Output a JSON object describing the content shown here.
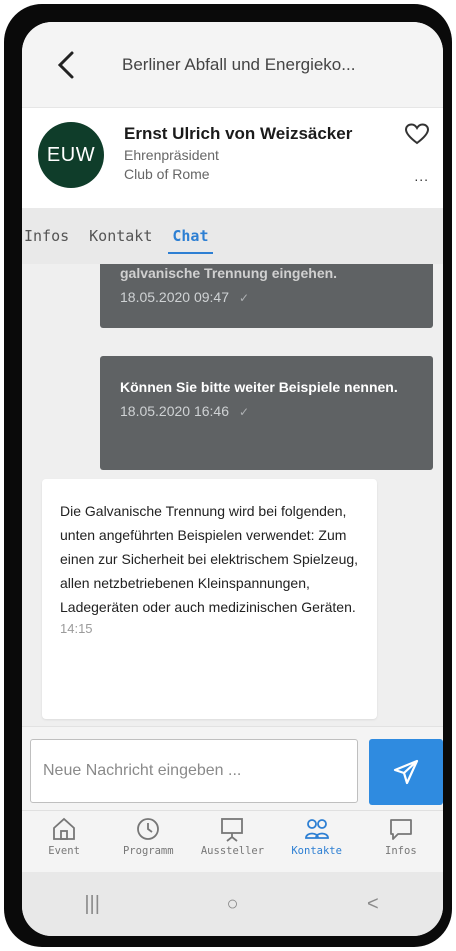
{
  "header": {
    "title": "Berliner Abfall und Energieko..."
  },
  "profile": {
    "avatar_initials": "EUW",
    "name": "Ernst Ulrich von Weizsäcker",
    "role": "Ehrenpräsident",
    "organization": "Club of Rome",
    "more_label": "..."
  },
  "tabs": [
    {
      "label": "Infos",
      "active": false
    },
    {
      "label": "Kontakt",
      "active": false
    },
    {
      "label": "Chat",
      "active": true
    }
  ],
  "messages": [
    {
      "direction": "out",
      "text": "galvanische Trennung eingehen.",
      "time": "18.05.2020 09:47",
      "status": "✓"
    },
    {
      "direction": "out",
      "text": "Können Sie bitte weiter Beispiele nennen.",
      "time": "18.05.2020 16:46",
      "status": "✓"
    },
    {
      "direction": "in",
      "text": "Die Galvanische Trennung wird bei folgenden, unten angeführten Beispielen verwendet: Zum einen zur Sicherheit bei elektrischem Spielzeug, allen netzbetriebenen Kleinspannungen, Ladegeräten oder auch medizinischen Geräten.",
      "time": "14:15"
    }
  ],
  "composer": {
    "placeholder": "Neue Nachricht eingeben ..."
  },
  "bottom_nav": [
    {
      "label": "Event",
      "icon": "home-icon",
      "active": false
    },
    {
      "label": "Programm",
      "icon": "clock-icon",
      "active": false
    },
    {
      "label": "Aussteller",
      "icon": "presentation-icon",
      "active": false
    },
    {
      "label": "Kontakte",
      "icon": "people-icon",
      "active": true
    },
    {
      "label": "Infos",
      "icon": "chat-bubble-icon",
      "active": false
    }
  ],
  "system_nav": {
    "recents": "|||",
    "home": "○",
    "back": "<"
  },
  "colors": {
    "accent": "#2d7fd3",
    "send_button": "#2f8be0",
    "avatar_bg": "#0f3d2a",
    "outgoing_bubble": "#5f6264"
  }
}
